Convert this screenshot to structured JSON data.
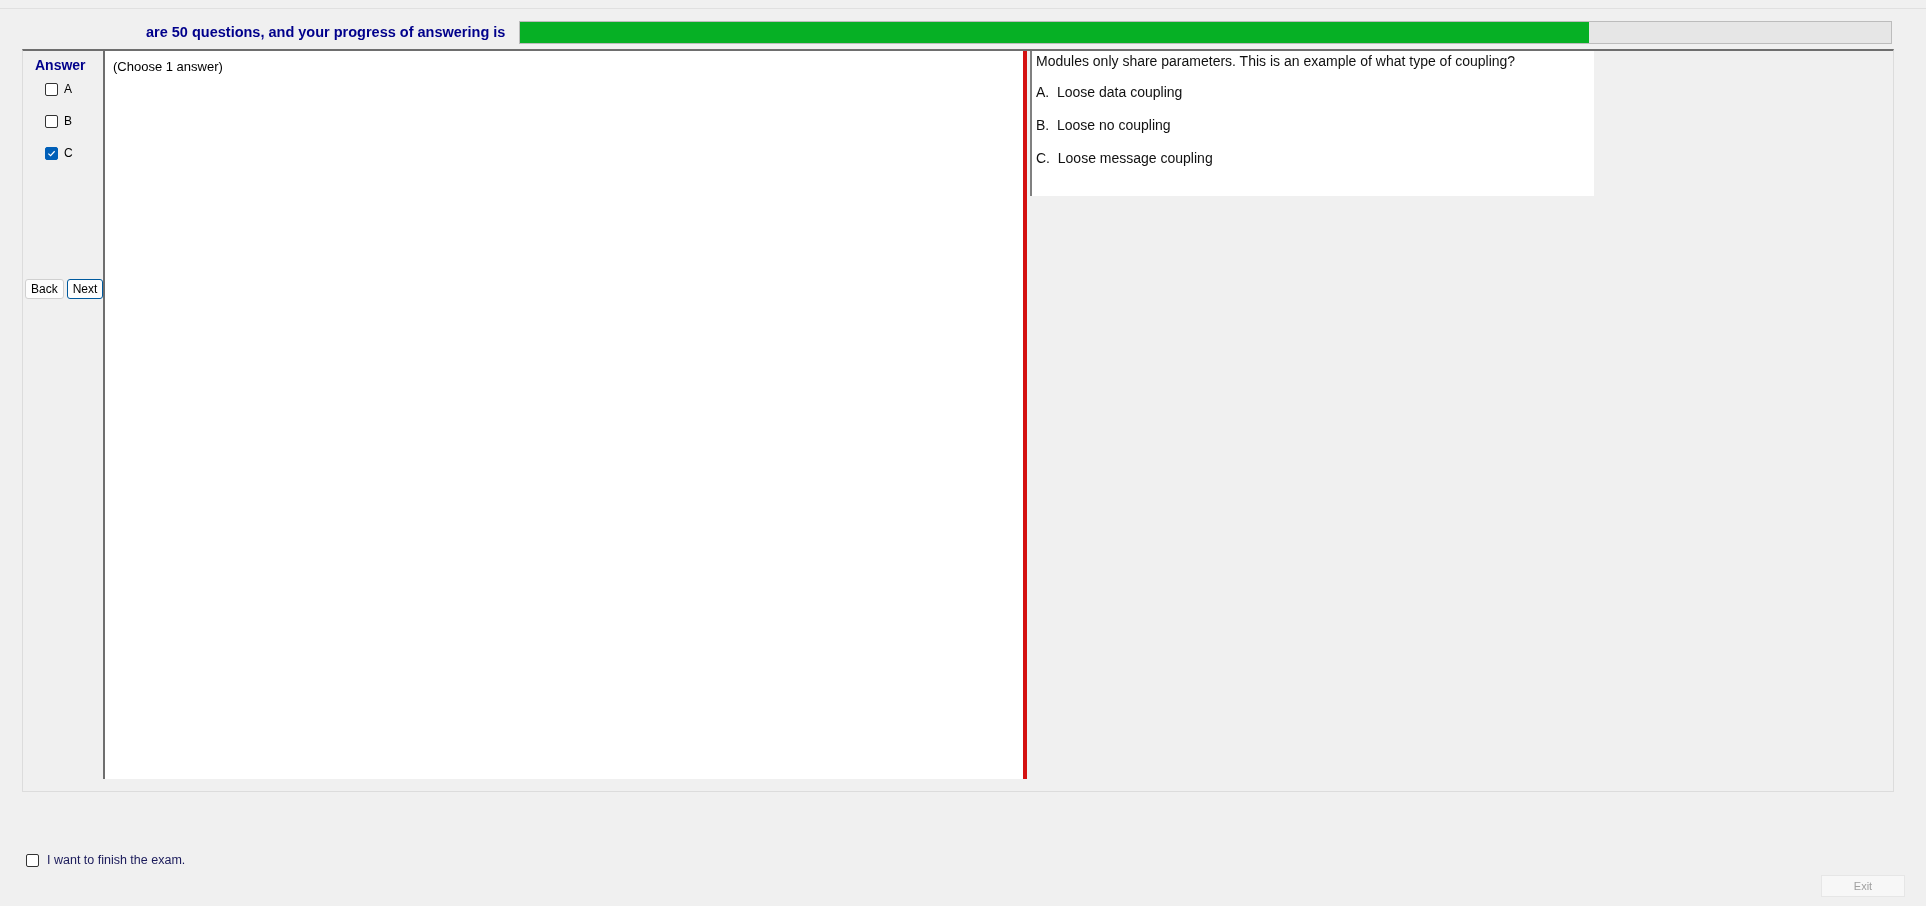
{
  "header": {
    "text": "are 50 questions, and your progress of answering is",
    "progress": {
      "level": 0.78
    }
  },
  "answer_panel": {
    "title": "Answer",
    "options": [
      {
        "label": "A",
        "checked": false
      },
      {
        "label": "B",
        "checked": false
      },
      {
        "label": "C",
        "checked": true
      }
    ],
    "buttons": [
      {
        "label": "Back",
        "focused": false
      },
      {
        "label": "Next",
        "focused": true
      }
    ]
  },
  "instruction": "(Choose 1 answer)",
  "question": {
    "text": "Modules only share parameters. This is an example of what type of coupling?",
    "choices": [
      "A.  Loose data coupling",
      "B.  Loose no coupling",
      "C.  Loose message coupling"
    ]
  },
  "finish": {
    "label": "I want to finish the exam.",
    "checked": false
  },
  "exit_button": {
    "label": "Exit",
    "disabled": true
  }
}
